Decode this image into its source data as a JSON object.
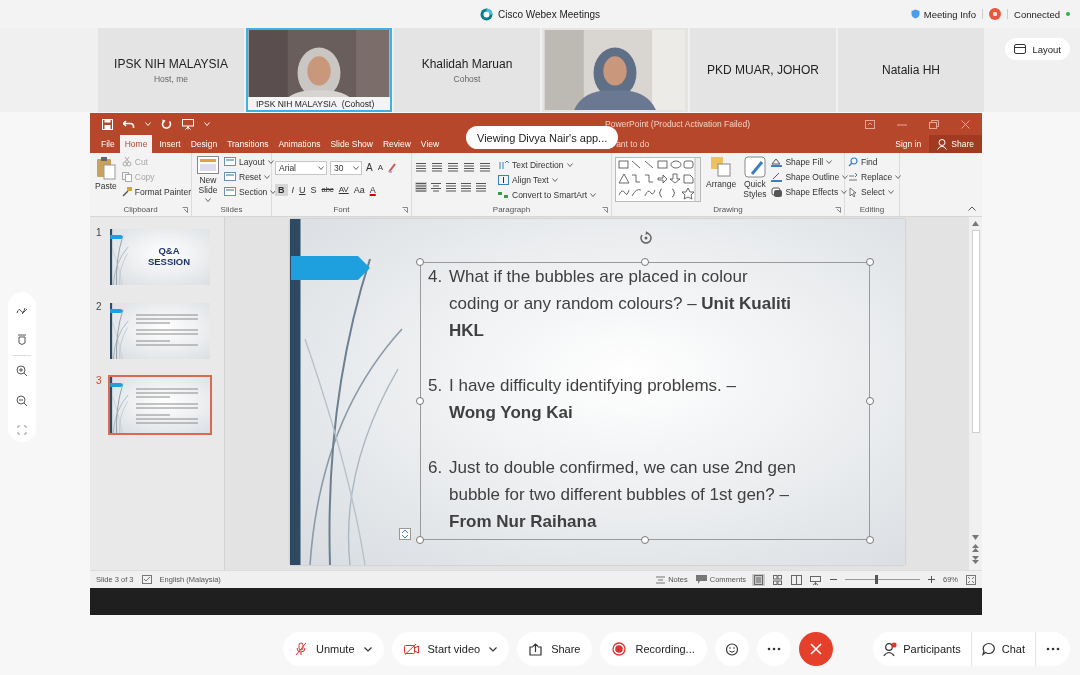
{
  "webex": {
    "title": "Cisco Webex Meetings",
    "meeting_info": "Meeting Info",
    "connection": "Connected",
    "connected": true
  },
  "participants": [
    {
      "kind": "name",
      "name": "IPSK NIH MALAYSIA",
      "role": "Host, me"
    },
    {
      "kind": "video",
      "label": "IPSK NIH MALAYSIA",
      "role": "(Cohost)",
      "active": true
    },
    {
      "kind": "name",
      "name": "Khalidah Maruan",
      "role": "Cohost"
    },
    {
      "kind": "video",
      "active": false
    },
    {
      "kind": "name",
      "name": "PKD MUAR, JOHOR"
    },
    {
      "kind": "name",
      "name": "Natalia HH"
    }
  ],
  "layout_button": "Layout",
  "share_banner": "Viewing Divya Nair's app...",
  "powerpoint": {
    "title": "PowerPoint (Product Activation Failed)",
    "tell_me": "ant to do",
    "sign_in": "Sign in",
    "share": "Share",
    "tabs": [
      {
        "label": "File",
        "selected": false
      },
      {
        "label": "Home",
        "selected": true
      },
      {
        "label": "Insert",
        "selected": false
      },
      {
        "label": "Design",
        "selected": false
      },
      {
        "label": "Transitions",
        "selected": false
      },
      {
        "label": "Animations",
        "selected": false
      },
      {
        "label": "Slide Show",
        "selected": false
      },
      {
        "label": "Review",
        "selected": false
      },
      {
        "label": "View",
        "selected": false
      }
    ],
    "groups": [
      {
        "kind": "clipboard",
        "label": "Clipboard",
        "large": "Paste",
        "items": [
          {
            "text": "Cut",
            "disabled": true
          },
          {
            "text": "Copy",
            "disabled": true
          },
          {
            "text": "Format Painter",
            "disabled": false
          }
        ]
      },
      {
        "kind": "slides",
        "label": "Slides",
        "large": "New Slide",
        "items": [
          {
            "text": "Layout"
          },
          {
            "text": "Reset"
          },
          {
            "text": "Section"
          }
        ]
      },
      {
        "kind": "font",
        "label": "Font",
        "font": "Arial",
        "size": "30",
        "size_buttons": [
          "A",
          "A"
        ],
        "buttons": [
          "B",
          "I",
          "U",
          "S",
          "abc",
          "AV",
          "Aa",
          "A"
        ]
      },
      {
        "kind": "paragraph",
        "label": "Paragraph",
        "items": [
          {
            "text": "Text Direction"
          },
          {
            "text": "Align Text"
          },
          {
            "text": "Convert to SmartArt"
          }
        ]
      },
      {
        "kind": "drawing",
        "label": "Drawing",
        "large": [
          "Arrange",
          "Quick Styles"
        ],
        "items": [
          {
            "text": "Shape Fill"
          },
          {
            "text": "Shape Outline"
          },
          {
            "text": "Shape Effects"
          }
        ]
      },
      {
        "kind": "editing",
        "label": "Editing",
        "items": [
          {
            "text": "Find"
          },
          {
            "text": "Replace"
          },
          {
            "text": "Select"
          }
        ]
      }
    ],
    "thumbnails": [
      {
        "number": "1",
        "title": "Q&A SESSION",
        "selected": false
      },
      {
        "number": "2",
        "selected": false
      },
      {
        "number": "3",
        "selected": true
      }
    ],
    "slide": {
      "items": [
        {
          "number": "4.",
          "text": "What if the bubbles are placed in colour\ncoding or any random colours? – **Unit Kualiti**\n**HKL**"
        },
        {
          "number": "5.",
          "text": "I have difficulty identifying problems. –\n**Wong Yong Kai**"
        },
        {
          "number": "6.",
          "text": "Just to double confirmed, we can use 2nd gen\nbubble for two different bubbles of 1st gen? –\n**From Nur Raihana**"
        }
      ]
    },
    "status": {
      "slide_info": "Slide 3 of 3",
      "language": "English (Malaysia)",
      "notes": "Notes",
      "comments": "Comments",
      "views": [
        {
          "selected": true
        },
        {
          "selected": false
        },
        {
          "selected": false
        },
        {
          "selected": false
        }
      ],
      "zoom": {
        "level": 0.42
      },
      "zoom_percent": "69%"
    }
  },
  "toolbar": {
    "buttons": [
      {
        "kind": "mute",
        "label": "Unmute",
        "dropdown": true
      },
      {
        "kind": "video",
        "label": "Start video",
        "dropdown": true
      },
      {
        "kind": "share",
        "label": "Share",
        "dropdown": false
      },
      {
        "kind": "record",
        "label": "Recording...",
        "dropdown": false
      },
      {
        "kind": "reactions"
      },
      {
        "kind": "more"
      },
      {
        "kind": "end"
      }
    ],
    "right": [
      {
        "kind": "participants",
        "label": "Participants",
        "badge": true
      },
      {
        "kind": "chat",
        "label": "Chat",
        "badge": false
      },
      {
        "kind": "more"
      }
    ]
  }
}
